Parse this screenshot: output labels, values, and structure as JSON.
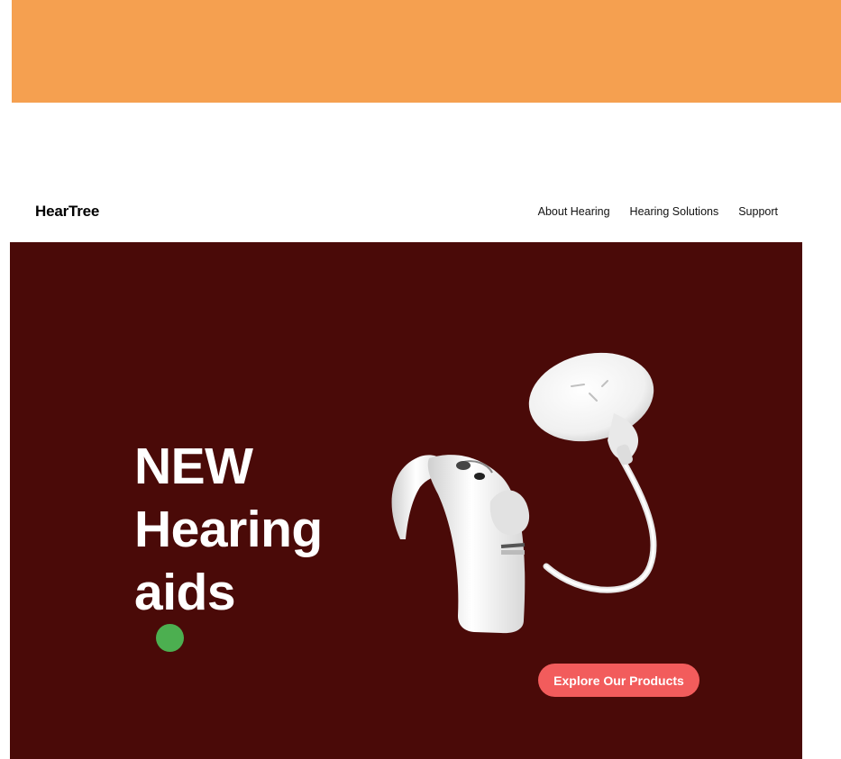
{
  "colors": {
    "banner": "#F5A050",
    "hero_bg": "#4A0A08",
    "accent_dot": "#4CAF50",
    "cta_bg": "#F25C5C"
  },
  "nav": {
    "brand": "HearTree",
    "links": [
      "About Hearing",
      "Hearing Solutions",
      "Support"
    ]
  },
  "hero": {
    "heading_lines": [
      "NEW",
      "Hearing",
      "aids"
    ],
    "cta_label": "Explore Our Products"
  }
}
